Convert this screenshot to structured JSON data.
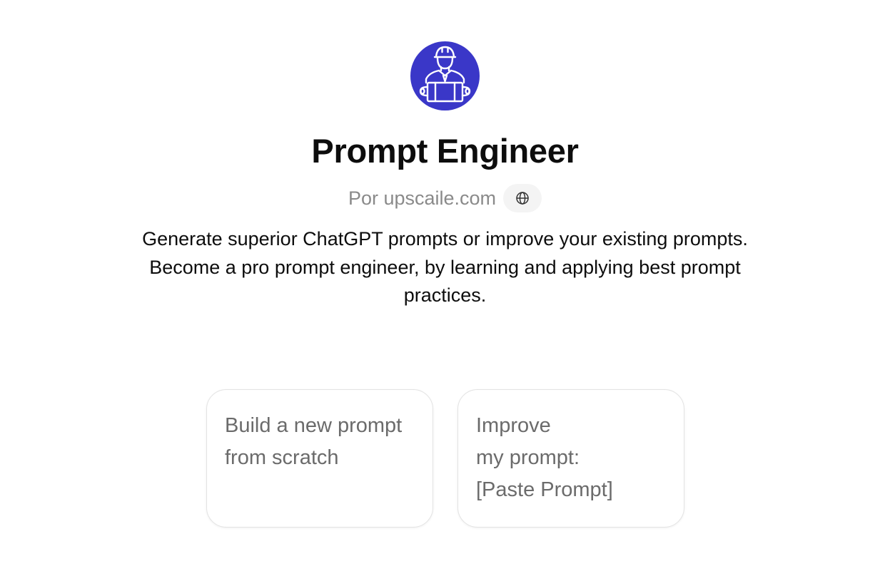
{
  "gpt": {
    "name": "Prompt Engineer",
    "byline": "Por upscaile.com",
    "description": "Generate superior ChatGPT prompts or improve your existing prompts. Become a pro prompt engineer, by learning and applying best prompt practices.",
    "avatar_icon": "engineer-with-hardhat-icon",
    "website_icon": "globe-icon"
  },
  "conversation_starters": [
    {
      "text": "Build a new prompt\nfrom scratch"
    },
    {
      "text": "Improve\nmy prompt:\n[Paste Prompt]"
    }
  ],
  "colors": {
    "avatar_bg": "#3a37c8",
    "title": "#0d0d0d",
    "muted": "#8a8a8a",
    "starter_text": "#6b6b6b"
  }
}
